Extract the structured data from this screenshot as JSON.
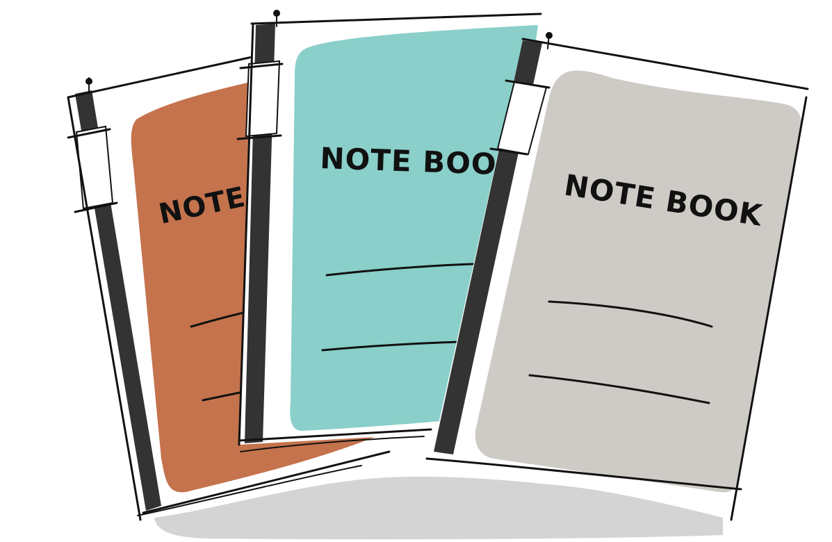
{
  "illustration": {
    "notebooks": [
      {
        "title": "NOTE BOOK",
        "cover_color": "#C4734D"
      },
      {
        "title": "NOTE BOOK",
        "cover_color": "#8ACFC9"
      },
      {
        "title": "NOTE BOOK",
        "cover_color": "#CECBC6"
      }
    ],
    "colors": {
      "spine": "#333333",
      "paper": "#ffffff",
      "shadow": "#D4D4D4",
      "ink": "#111111"
    }
  }
}
